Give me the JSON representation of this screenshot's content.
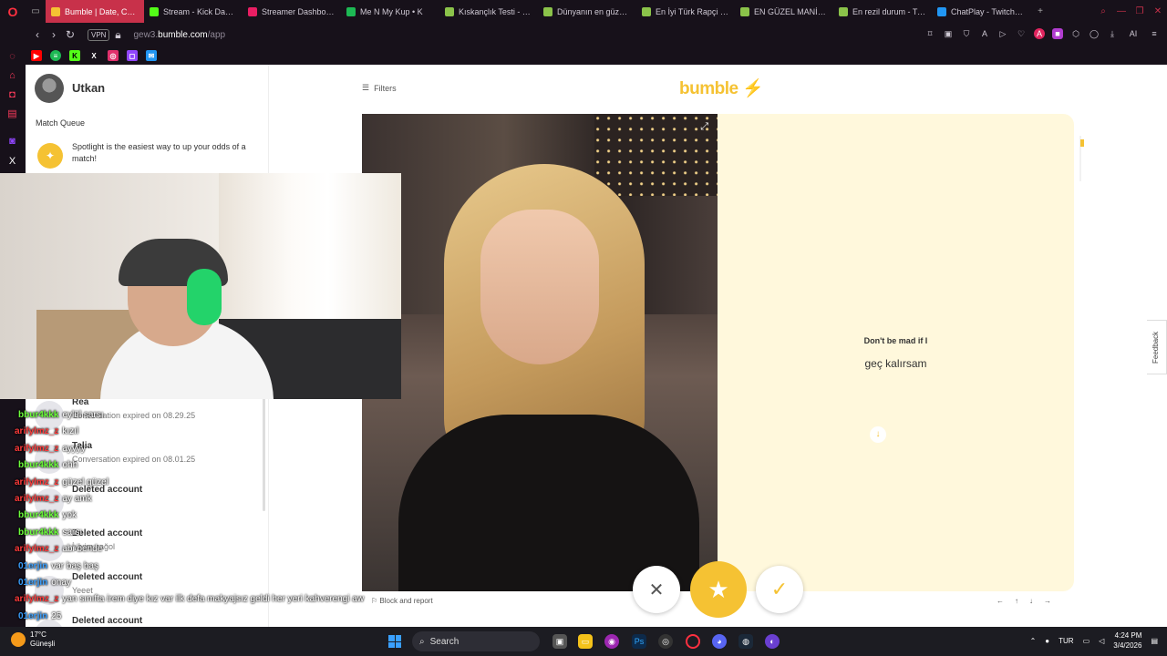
{
  "browser": {
    "tabs": [
      {
        "title": "Bumble | Date, Chat, Meet",
        "color": "#f5c233",
        "active": true
      },
      {
        "title": "Stream - Kick Dashboard",
        "color": "#53fc18",
        "active": false
      },
      {
        "title": "Streamer Dashboard",
        "color": "#e91e63",
        "active": false
      },
      {
        "title": "Me N My Kup • K",
        "color": "#1db954",
        "active": false
      },
      {
        "title": "Kıskançlık Testi - Tier",
        "color": "#8bc34a",
        "active": false
      },
      {
        "title": "Dünyanın en güzel şe",
        "color": "#8bc34a",
        "active": false
      },
      {
        "title": "En İyi Türk Rapçi - Tie",
        "color": "#8bc34a",
        "active": false
      },
      {
        "title": "EN GÜZEL MANİFES",
        "color": "#8bc34a",
        "active": false
      },
      {
        "title": "En rezil durum - Tier",
        "color": "#8bc34a",
        "active": false
      },
      {
        "title": "ChatPlay - Twitch & K",
        "color": "#2196f3",
        "active": false
      }
    ],
    "new_tab": "+",
    "vpn_label": "VPN",
    "url_prefix": "gew3.",
    "url_domain": "bumble.com",
    "url_path": "/app",
    "ai_label": "AI"
  },
  "profile": {
    "name": "Utkan",
    "match_queue": "Match Queue",
    "spotlight": "Spotlight is the easiest way to up your odds of a match!"
  },
  "conversations": [
    {
      "name": "Rea",
      "status": "Conversation expired on 08.29.25"
    },
    {
      "name": "Talia",
      "status": "Conversation expired on 08.01.25"
    },
    {
      "name": "Deleted account",
      "status": ""
    },
    {
      "name": "Deleted account",
      "status": "İyiyim sağol"
    },
    {
      "name": "Deleted account",
      "status": "Yeeet"
    },
    {
      "name": "Deleted account",
      "status": ""
    }
  ],
  "main": {
    "filters": "Filters",
    "logo": "bumble",
    "prompt_question": "Don't be mad if I",
    "prompt_answer": "geç kalırsam",
    "block_report": "Block and report",
    "keys": [
      "←",
      "↑",
      "↓",
      "→"
    ],
    "feedback": "Feedback"
  },
  "chat": [
    {
      "user": "bbur4kkk",
      "text": "eylül sarsı",
      "color": "#6cff3a"
    },
    {
      "user": "arifylmz_z",
      "text": "kızıl",
      "color": "#ff3b3b"
    },
    {
      "user": "arifylmz_z",
      "text": "ayyyy",
      "color": "#ff3b3b"
    },
    {
      "user": "bbur4kkk",
      "text": "ohh",
      "color": "#6cff3a"
    },
    {
      "user": "arifylmz_z",
      "text": "güzel güzel",
      "color": "#ff3b3b"
    },
    {
      "user": "arifylmz_z",
      "text": "ay amk",
      "color": "#ff3b3b"
    },
    {
      "user": "bbur4kkk",
      "text": "yok",
      "color": "#6cff3a"
    },
    {
      "user": "bbur4kkk",
      "text": "sarsı",
      "color": "#6cff3a"
    },
    {
      "user": "arifylmz_z",
      "text": "abi bende",
      "color": "#ff3b3b"
    },
    {
      "user": "01erjin",
      "text": "var baş baş",
      "color": "#3aa0ff"
    },
    {
      "user": "01erjin",
      "text": "onay",
      "color": "#3aa0ff"
    },
    {
      "user": "arifylmz_z",
      "text": "yan sınıfta irem diye kız var ilk defa makyajsız geldi her yeri kahverengi aw",
      "color": "#ff3b3b"
    },
    {
      "user": "01erjin",
      "text": "25",
      "color": "#3aa0ff"
    }
  ],
  "taskbar": {
    "temp": "17°C",
    "weather": "Güneşli",
    "search": "Search",
    "lang": "TUR",
    "time": "4:24 PM",
    "date": "3/4/2026"
  }
}
